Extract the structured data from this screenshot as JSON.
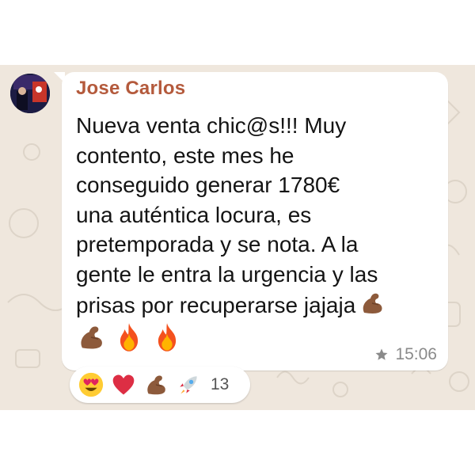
{
  "chat": {
    "background_color": "#efe7dd",
    "bubble_color": "#ffffff"
  },
  "message": {
    "sender_name": "Jose Carlos",
    "sender_color": "#b45a3c",
    "avatar_icon": "avatar-photo",
    "lines": [
      "Nueva venta chic@s!!! Muy",
      "contento, este mes he",
      "conseguido generar 1780€",
      "una auténtica locura, es",
      "pretemporada y se nota. A la",
      "gente le entra la urgencia y las",
      "prisas por recuperarse jajaja"
    ],
    "trailing_emoji": "flexed-biceps-emoji",
    "emoji_line": [
      "flexed-biceps-emoji",
      "fire-emoji",
      "fire-emoji"
    ],
    "starred": true,
    "time": "15:06"
  },
  "reactions": {
    "emojis": [
      "heart-eyes-emoji",
      "red-heart-emoji",
      "flexed-biceps-emoji",
      "rocket-emoji"
    ],
    "count": "13"
  }
}
